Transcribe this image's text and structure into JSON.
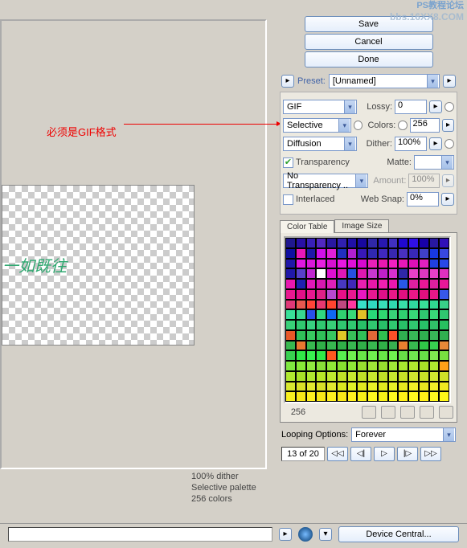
{
  "watermark": {
    "line1": "PS教程论坛",
    "line2": "bbs.16XX8.COM"
  },
  "annotation": {
    "hint": "必须是GIF格式"
  },
  "preview": {
    "sample_text": "一如既往",
    "info_line1": "100% dither",
    "info_line2": "Selective palette",
    "info_line3": "256 colors"
  },
  "buttons": {
    "save": "Save",
    "cancel": "Cancel",
    "done": "Done",
    "device_central": "Device Central..."
  },
  "preset": {
    "label": "Preset:",
    "value": "[Unnamed]"
  },
  "settings": {
    "format": "GIF",
    "lossy_label": "Lossy:",
    "lossy_value": "0",
    "reduction": "Selective",
    "colors_label": "Colors:",
    "colors_value": "256",
    "dither_method": "Diffusion",
    "dither_label": "Dither:",
    "dither_value": "100%",
    "transparency_label": "Transparency",
    "transparency_checked": true,
    "matte_label": "Matte:",
    "matte_value": "",
    "trans_dither": "No Transparency ..",
    "amount_label": "Amount:",
    "amount_value": "100%",
    "interlaced_label": "Interlaced",
    "interlaced_checked": false,
    "websnap_label": "Web Snap:",
    "websnap_value": "0%"
  },
  "tabs": {
    "color_table": "Color Table",
    "image_size": "Image Size"
  },
  "color_table": {
    "count": "256"
  },
  "looping": {
    "label": "Looping Options:",
    "value": "Forever"
  },
  "frames": {
    "info": "13 of 20",
    "first": "◁◁",
    "prev": "◁|",
    "play": "▷",
    "next": "|▷",
    "last": "▷▷"
  },
  "chart_data": {
    "type": "heatmap",
    "title": "Color Table",
    "grid": "16x16",
    "count": 256,
    "palette_rows": [
      [
        "#20188f",
        "#2810a6",
        "#3820b8",
        "#5028c0",
        "#2818a0",
        "#3020b0",
        "#2010a8",
        "#1808a0",
        "#3028a8",
        "#2818b0",
        "#4030c0",
        "#2008d0",
        "#3010e8",
        "#1800a8",
        "#2818a0",
        "#3010b8"
      ],
      [
        "#1010a0",
        "#e818b8",
        "#2018a8",
        "#d010e8",
        "#e020d8",
        "#2030c0",
        "#b020d0",
        "#3818b8",
        "#3028b0",
        "#4028c0",
        "#3828b0",
        "#4830c0",
        "#3828b8",
        "#4040c8",
        "#1838e0",
        "#3848e0"
      ],
      [
        "#2018a8",
        "#e018e0",
        "#d818d8",
        "#e820e0",
        "#d810d0",
        "#e818e0",
        "#e010d8",
        "#d808d0",
        "#e820b8",
        "#e818b0",
        "#f020c0",
        "#e818b8",
        "#e010b8",
        "#e020c0",
        "#2040e0",
        "#2848e8"
      ],
      [
        "#2018a8",
        "#5840c8",
        "#c028d0",
        "#ffffff",
        "#e010d0",
        "#e018b8",
        "#2850e0",
        "#e018b0",
        "#c838d0",
        "#c020c8",
        "#d830d0",
        "#3028a8",
        "#e840c8",
        "#e038c0",
        "#e840c8",
        "#e030c0"
      ],
      [
        "#e818b0",
        "#2020b0",
        "#e018b8",
        "#d818b0",
        "#e020b8",
        "#4838c0",
        "#4028b8",
        "#e820b0",
        "#e818a8",
        "#f020b0",
        "#e818b0",
        "#2858e8",
        "#e020a0",
        "#e81898",
        "#e020a0",
        "#e81898"
      ],
      [
        "#e81890",
        "#e01088",
        "#e81890",
        "#e02088",
        "#b848d0",
        "#e81088",
        "#e81890",
        "#e818c0",
        "#e81890",
        "#e01088",
        "#e81888",
        "#e01080",
        "#e81888",
        "#e01080",
        "#e81888",
        "#3858e8"
      ],
      [
        "#e03878",
        "#e85850",
        "#ff4438",
        "#e83870",
        "#ff4430",
        "#c04880",
        "#ff38a0",
        "#38e0c8",
        "#30d8c0",
        "#38e0b8",
        "#30d8b0",
        "#38e0a8",
        "#30d8a0",
        "#38e098",
        "#30d890",
        "#38d088"
      ],
      [
        "#38e098",
        "#38d890",
        "#2850e8",
        "#30d880",
        "#1068f0",
        "#30d070",
        "#38d878",
        "#e0c028",
        "#28d878",
        "#30d870",
        "#38d078",
        "#30d070",
        "#38d878",
        "#30c870",
        "#38d878",
        "#30c870"
      ],
      [
        "#38d078",
        "#30c870",
        "#38d080",
        "#30c870",
        "#38d078",
        "#30c870",
        "#30c870",
        "#28c068",
        "#30c870",
        "#28c068",
        "#30c870",
        "#28c068",
        "#30c870",
        "#28c068",
        "#30c068",
        "#28c060"
      ],
      [
        "#e85828",
        "#30c058",
        "#38c860",
        "#30c058",
        "#38c860",
        "#e0c828",
        "#38c058",
        "#30c058",
        "#e06838",
        "#30c050",
        "#ff5028",
        "#30b050",
        "#38b858",
        "#30b050",
        "#38b858",
        "#30b050"
      ],
      [
        "#38b850",
        "#e87830",
        "#38b850",
        "#30b048",
        "#38b850",
        "#30b048",
        "#38b850",
        "#30b048",
        "#38b850",
        "#30b048",
        "#38b050",
        "#e88030",
        "#38b850",
        "#30c848",
        "#38d050",
        "#e88838"
      ],
      [
        "#38d050",
        "#30e848",
        "#38f050",
        "#30e848",
        "#ff5820",
        "#58f050",
        "#70f050",
        "#68e848",
        "#70f050",
        "#68e848",
        "#70f050",
        "#68e048",
        "#70e850",
        "#68e048",
        "#80e850",
        "#78e040"
      ],
      [
        "#80e840",
        "#88e838",
        "#90e840",
        "#88e038",
        "#90e838",
        "#88e030",
        "#90e838",
        "#98e030",
        "#a0e838",
        "#98e030",
        "#a0e838",
        "#a8e830",
        "#b0e830",
        "#a8e028",
        "#b0e830",
        "#ffa018"
      ],
      [
        "#b0e830",
        "#a8e028",
        "#b0e830",
        "#b8e828",
        "#c0e830",
        "#c0e028",
        "#c8e830",
        "#c0e028",
        "#c8e830",
        "#c0e028",
        "#c8e830",
        "#c8e028",
        "#d0e830",
        "#c8e028",
        "#d0e830",
        "#d0e028"
      ],
      [
        "#d8e830",
        "#d8e028",
        "#e0e830",
        "#d8e028",
        "#e0e830",
        "#d8e820",
        "#e0f028",
        "#e0e820",
        "#e8f028",
        "#e0e820",
        "#e8f028",
        "#e8e820",
        "#f0f028",
        "#e8e820",
        "#f0f028",
        "#f0e820"
      ],
      [
        "#f8f020",
        "#f8e818",
        "#fff020",
        "#f8e818",
        "#fff020",
        "#f8e818",
        "#fff020",
        "#f8f018",
        "#fff820",
        "#f8f018",
        "#fff820",
        "#fff018",
        "#fff820",
        "#fff018",
        "#fff820",
        "#fff818"
      ]
    ]
  }
}
